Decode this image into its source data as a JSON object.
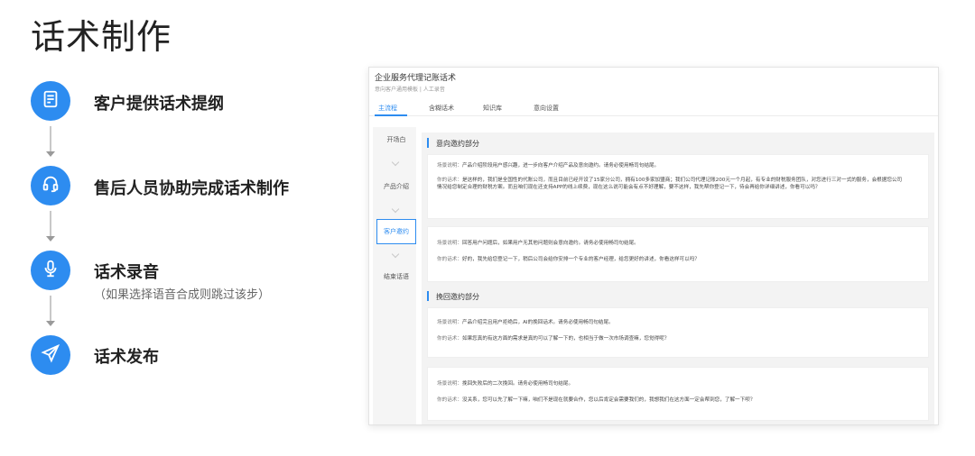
{
  "page": {
    "title": "话术制作"
  },
  "steps": [
    {
      "label": "客户提供话术提纲",
      "icon": "document-icon"
    },
    {
      "label": "售后人员协助完成话术制作",
      "icon": "headset-icon"
    },
    {
      "label": "话术录音",
      "sub": "（如果选择语音合成则跳过该步）",
      "icon": "microphone-icon"
    },
    {
      "label": "话术发布",
      "icon": "send-icon"
    }
  ],
  "app": {
    "title": "企业服务代理记账话术",
    "subtitle": "意向客户通用模板 | 人工录音",
    "tabs": [
      "主流程",
      "含糊话术",
      "知识库",
      "意向设置"
    ],
    "side_items": [
      "开场白",
      "产品介绍",
      "客户邀约",
      "结束话语"
    ],
    "sections": [
      {
        "title": "意向邀约部分",
        "cards": [
          {
            "scene_label": "场景说明：",
            "scene": "产品介绍阶段用户感兴趣，进一步向客户介绍产品及意向邀约。请务必使用畅司句结尾。",
            "reply_label": "你的话术：",
            "reply": "是这样的，我们是全国性的代账公司，而且目前已经开设了15家分公司，拥有100多家加盟商；我们公司代理记账200元一个月起，有专业的财税服务团队，对您进行三对一式的服务，会根据您公司情况给您制定合理的财税方案。而且咱们现在还支持APP的线上续费，现在这么说可能会有点不好理解，要不这样，我先帮你登记一下，待会再给你详细讲述，你看可以吗？"
          },
          {
            "scene_label": "场景说明：",
            "scene": "回答用户问题后，如果用户无其他问题则会意向邀约。请务必使用畅司句结尾。",
            "reply_label": "你的话术：",
            "reply": "好的，我先给您登记一下，稍后公司会给你安排一个专业的客户经理，给您更好的讲述，你看这样可以吗？"
          }
        ]
      },
      {
        "title": "挽回邀约部分",
        "cards": [
          {
            "scene_label": "场景说明：",
            "scene": "产品介绍完且用户拒绝后，AI的挽回话术。请务必使用畅司句结尾。",
            "reply_label": "你的话术：",
            "reply": "如果您真的有这方面的需求是真的可以了解一下的，也相当于做一次市场调查嘛，您觉得呢？"
          },
          {
            "scene_label": "场景说明：",
            "scene": "挽回失败后的二次挽回。请务必使用畅司句结尾。",
            "reply_label": "你的话术：",
            "reply": "没关系，您可以先了解一下嘛，咱们不是现在就要合作，您以后肯定会需要我们的，我想我们在这方面一定会帮到您，了解一下呗？"
          }
        ]
      }
    ]
  },
  "colors": {
    "accent": "#2d8cf0"
  }
}
